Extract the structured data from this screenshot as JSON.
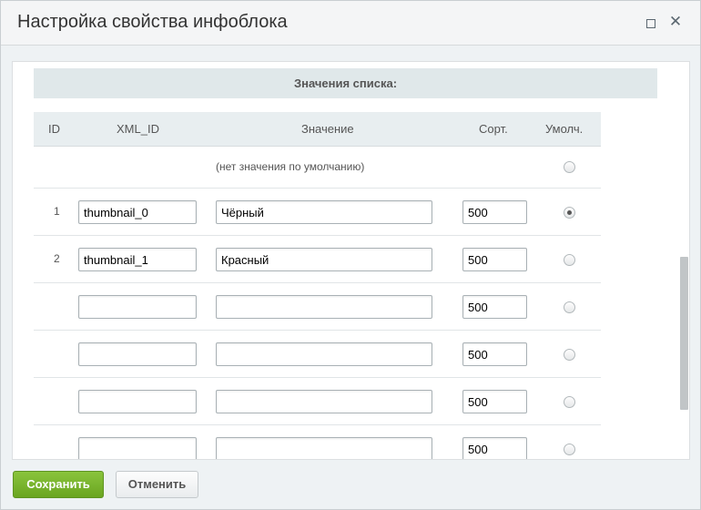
{
  "dialog": {
    "title": "Настройка свойства инфоблока"
  },
  "section": {
    "header": "Значения списка:"
  },
  "table": {
    "columns": {
      "id": "ID",
      "xml_id": "XML_ID",
      "value": "Значение",
      "sort": "Сорт.",
      "default": "Умолч."
    },
    "no_default_label": "(нет значения по умолчанию)",
    "rows": [
      {
        "id": "1",
        "xml_id": "thumbnail_0",
        "value": "Чёрный",
        "sort": "500",
        "default_checked": true
      },
      {
        "id": "2",
        "xml_id": "thumbnail_1",
        "value": "Красный",
        "sort": "500",
        "default_checked": false
      },
      {
        "id": "",
        "xml_id": "",
        "value": "",
        "sort": "500",
        "default_checked": false
      },
      {
        "id": "",
        "xml_id": "",
        "value": "",
        "sort": "500",
        "default_checked": false
      },
      {
        "id": "",
        "xml_id": "",
        "value": "",
        "sort": "500",
        "default_checked": false
      },
      {
        "id": "",
        "xml_id": "",
        "value": "",
        "sort": "500",
        "default_checked": false
      }
    ]
  },
  "buttons": {
    "save": "Сохранить",
    "cancel": "Отменить"
  },
  "icons": {
    "maximize": "maximize-icon",
    "close": "close-icon"
  }
}
